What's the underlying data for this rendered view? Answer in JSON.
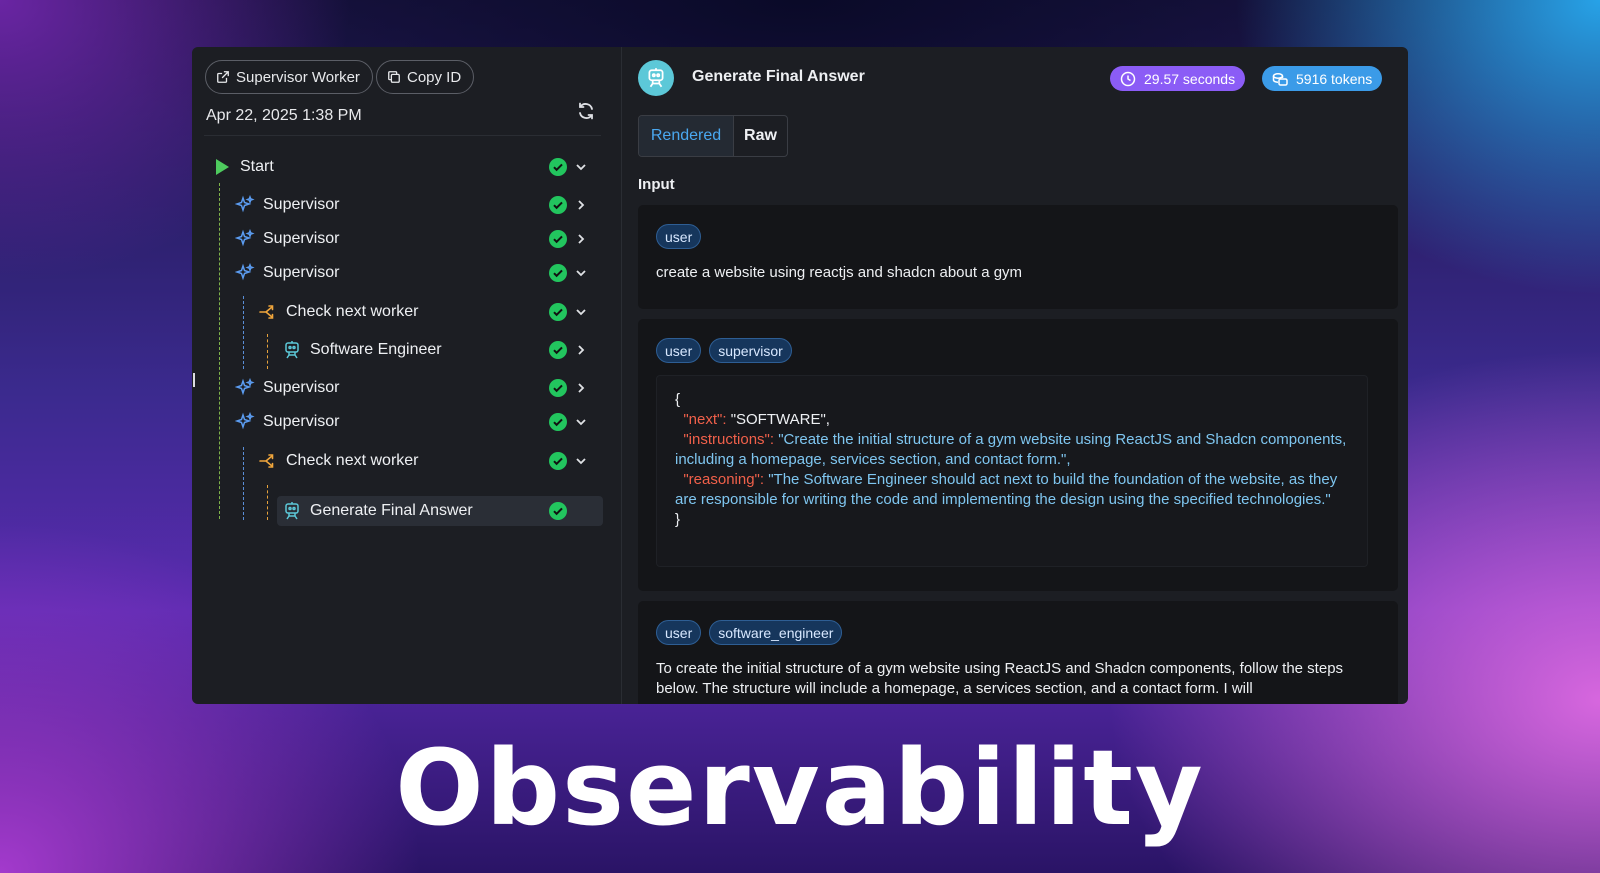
{
  "header_left": {
    "worker_button": "Supervisor Worker",
    "copy_button": "Copy ID",
    "date": "Apr 22, 2025 1:38 PM"
  },
  "tree": [
    {
      "label": "Start",
      "icon": "play-icon",
      "status": "success",
      "expand": "expanded"
    },
    {
      "label": "Supervisor",
      "icon": "sparkle-icon",
      "status": "success",
      "expand": "collapsed"
    },
    {
      "label": "Supervisor",
      "icon": "sparkle-icon",
      "status": "success",
      "expand": "collapsed"
    },
    {
      "label": "Supervisor",
      "icon": "sparkle-icon",
      "status": "success",
      "expand": "expanded"
    },
    {
      "label": "Check next worker",
      "icon": "branch-icon",
      "status": "success",
      "expand": "expanded"
    },
    {
      "label": "Software Engineer",
      "icon": "robot-icon",
      "status": "success",
      "expand": "collapsed"
    },
    {
      "label": "Supervisor",
      "icon": "sparkle-icon",
      "status": "success",
      "expand": "collapsed"
    },
    {
      "label": "Supervisor",
      "icon": "sparkle-icon",
      "status": "success",
      "expand": "expanded"
    },
    {
      "label": "Check next worker",
      "icon": "branch-icon",
      "status": "success",
      "expand": "expanded"
    },
    {
      "label": "Generate Final Answer",
      "icon": "robot-icon",
      "status": "success",
      "expand": "none",
      "selected": true
    }
  ],
  "detail": {
    "title": "Generate Final Answer",
    "duration": "29.57 seconds",
    "tokens": "5916 tokens",
    "tabs": {
      "rendered": "Rendered",
      "raw": "Raw",
      "active": "Rendered"
    },
    "input_label": "Input",
    "messages": [
      {
        "roles": [
          "user"
        ],
        "text": "create a website using reactjs and shadcn about a gym"
      },
      {
        "roles": [
          "user",
          "supervisor"
        ],
        "code": {
          "open": "{",
          "next_key": "\"next\":",
          "next_val": "\"SOFTWARE\",",
          "instructions_key": "\"instructions\":",
          "instructions_val": "\"Create the initial structure of a gym website using ReactJS and Shadcn components, including a homepage, services section, and contact form.\",",
          "reasoning_key": "\"reasoning\":",
          "reasoning_val": "\"The Software Engineer should act next to build the foundation of the website, as they are responsible for writing the code and implementing the design using the specified technologies.\"",
          "close": "}"
        }
      },
      {
        "roles": [
          "user",
          "software_engineer"
        ],
        "text": "To create the initial structure of a gym website using ReactJS and Shadcn components, follow the steps below. The structure will include a homepage, a services section, and a contact form. I will"
      }
    ]
  },
  "banner": "Observability",
  "colors": {
    "accent_blue": "#4aa8f0",
    "success_green": "#22c55e",
    "duration_badge": "#8b5cf6",
    "tokens_badge": "#3b9be8",
    "robot_icon_bg": "#5cc8d8",
    "branch_icon": "#f0a63c",
    "sparkle_icon": "#5b9cf0"
  }
}
